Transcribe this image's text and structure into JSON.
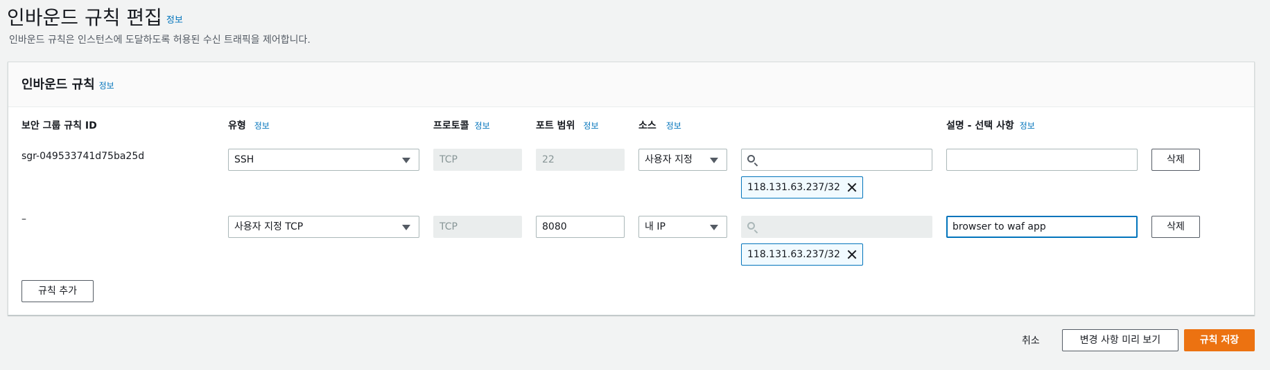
{
  "page": {
    "title": "인바운드 규칙 편집",
    "info": "정보",
    "description": "인바운드 규칙은 인스턴스에 도달하도록 허용된 수신 트래픽을 제어합니다."
  },
  "panel": {
    "title": "인바운드 규칙",
    "info": "정보",
    "columns": {
      "rule_id": "보안 그룹 규칙 ID",
      "type": "유형",
      "protocol": "프로토콜",
      "port_range": "포트 범위",
      "source": "소스",
      "description": "설명 - 선택 사항",
      "info": "정보"
    },
    "rows": [
      {
        "rule_id": "sgr-049533741d75ba25d",
        "type": "SSH",
        "protocol": "TCP",
        "port": "22",
        "source_type": "사용자 지정",
        "search_value": "",
        "cidr_token": "118.131.63.237/32",
        "description": "",
        "delete_label": "삭제"
      },
      {
        "rule_id": "–",
        "type": "사용자 지정 TCP",
        "protocol": "TCP",
        "port": "8080",
        "source_type": "내 IP",
        "search_value": "",
        "cidr_token": "118.131.63.237/32",
        "description": "browser to waf app",
        "delete_label": "삭제"
      }
    ],
    "add_rule_label": "규칙 추가"
  },
  "footer": {
    "cancel_label": "취소",
    "preview_label": "변경 사항 미리 보기",
    "save_label": "규칙 저장"
  },
  "colors": {
    "primary": "#ec7211",
    "link": "#0073bb",
    "token_border": "#0073bb",
    "disabled_bg": "#eaeded"
  }
}
